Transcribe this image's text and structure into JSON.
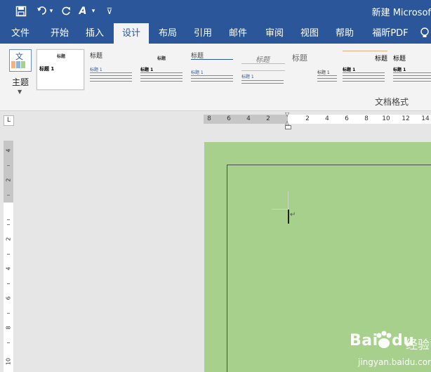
{
  "window": {
    "title": "新建 Microsof"
  },
  "quick_access": [
    {
      "name": "save-icon",
      "glyph": "💾"
    },
    {
      "name": "undo-icon",
      "glyph": "↶"
    },
    {
      "name": "undo-dropdown-icon",
      "glyph": "▾"
    },
    {
      "name": "redo-icon",
      "glyph": "↻"
    },
    {
      "name": "format-painter-icon",
      "glyph": "A"
    },
    {
      "name": "format-painter-dropdown-icon",
      "glyph": "▾"
    },
    {
      "name": "customize-qat-icon",
      "glyph": "⊽"
    }
  ],
  "tabs": [
    "文件",
    "开始",
    "插入",
    "设计",
    "布局",
    "引用",
    "邮件",
    "审阅",
    "视图",
    "帮助",
    "福昕PDF"
  ],
  "active_tab": "设计",
  "ribbon": {
    "theme_label": "主题",
    "theme_icon_text": "文",
    "group_label": "文档格式",
    "styles": [
      {
        "title": "标题",
        "heading": "标题 1"
      },
      {
        "title": "标题",
        "heading": "标题 1"
      },
      {
        "title": "标题",
        "heading": "标题 1"
      },
      {
        "title": "标题",
        "heading": "标题 1"
      },
      {
        "title": "标题",
        "heading": "标题 1"
      },
      {
        "title": "标题",
        "heading": "标题 1"
      },
      {
        "title": "标题",
        "heading": "标题 1"
      },
      {
        "title": "标题",
        "heading": "标题 1"
      }
    ]
  },
  "ruler": {
    "selector_label": "L",
    "h_labels": [
      "8",
      "6",
      "4",
      "2",
      "2",
      "4",
      "6",
      "8",
      "10",
      "12",
      "14"
    ],
    "v_labels": [
      "4",
      "2",
      "2",
      "4",
      "6",
      "8",
      "10"
    ]
  },
  "document": {
    "page_color": "#a8d08d",
    "paragraph_mark": "↵"
  },
  "watermark": {
    "brand": "Bai",
    "brand_rest": "du",
    "cn": "经验",
    "url": "jingyan.baidu.com"
  },
  "colors": {
    "accent": "#2b579a",
    "ribbon": "#f3f3f3",
    "workspace": "#e6e6e6"
  }
}
